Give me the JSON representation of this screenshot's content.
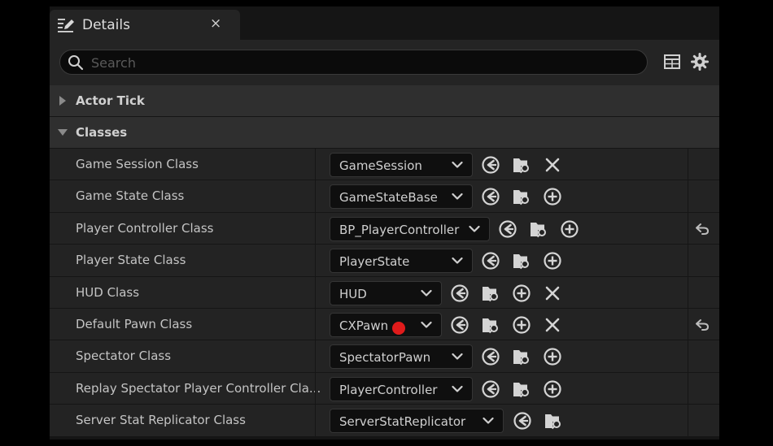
{
  "tab": {
    "title": "Details",
    "close_glyph": "×"
  },
  "search": {
    "placeholder": "Search",
    "value": ""
  },
  "toolbar": {
    "icons": [
      "table-view-icon",
      "settings-gear-icon"
    ]
  },
  "sections": [
    {
      "label": "Actor Tick",
      "expanded": false
    },
    {
      "label": "Classes",
      "expanded": true
    }
  ],
  "rows": [
    {
      "label": "Game Session Class",
      "value": "GameSession",
      "actions": [
        "use",
        "browse",
        "clear"
      ],
      "reset": false
    },
    {
      "label": "Game State Class",
      "value": "GameStateBase",
      "actions": [
        "use",
        "browse",
        "add"
      ],
      "reset": false
    },
    {
      "label": "Player Controller Class",
      "value": "BP_PlayerController",
      "actions": [
        "use",
        "browse",
        "add"
      ],
      "reset": true
    },
    {
      "label": "Player State Class",
      "value": "PlayerState",
      "actions": [
        "use",
        "browse",
        "add"
      ],
      "reset": false
    },
    {
      "label": "HUD Class",
      "value": "HUD",
      "actions": [
        "use",
        "browse",
        "add",
        "clear"
      ],
      "reset": false
    },
    {
      "label": "Default Pawn Class",
      "value": "CXPawn",
      "red_dot": true,
      "actions": [
        "use",
        "browse",
        "add",
        "clear"
      ],
      "reset": true
    },
    {
      "label": "Spectator Class",
      "value": "SpectatorPawn",
      "actions": [
        "use",
        "browse",
        "add"
      ],
      "reset": false
    },
    {
      "label": "Replay Spectator Player Controller Cla...",
      "value": "PlayerController",
      "actions": [
        "use",
        "browse",
        "add"
      ],
      "reset": false
    },
    {
      "label": "Server Stat Replicator Class",
      "value": "ServerStatReplicator",
      "actions": [
        "use",
        "browse"
      ],
      "reset": false
    }
  ],
  "colors": {
    "background": "#151515",
    "row": "#232323",
    "section": "#2f2f2f",
    "text": "#c4c4c4",
    "dirty_marker": "#e01b1b"
  }
}
